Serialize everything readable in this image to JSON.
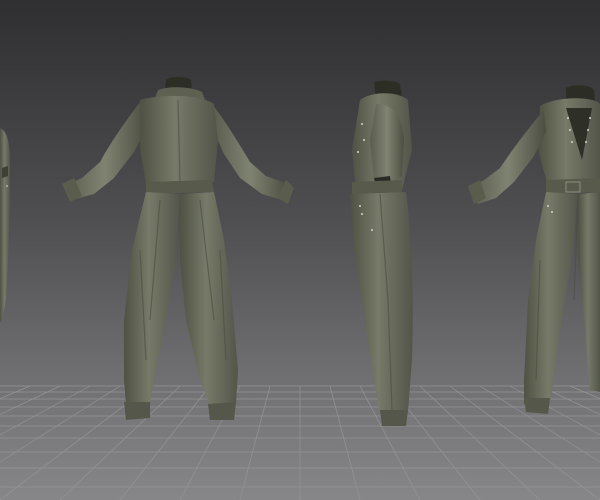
{
  "scene": {
    "description_icon": "3d-viewport",
    "garment_color": "#6b6d5d",
    "garment_shadow": "#4a4c40",
    "garment_highlight": "#8a8c7a",
    "collar_color": "#2c2e26",
    "background_top": "#2f2f31",
    "background_bottom": "#858587",
    "grid_color": "#9a9a9c",
    "views": [
      "left-partial",
      "back",
      "side",
      "front-three-quarter"
    ]
  }
}
